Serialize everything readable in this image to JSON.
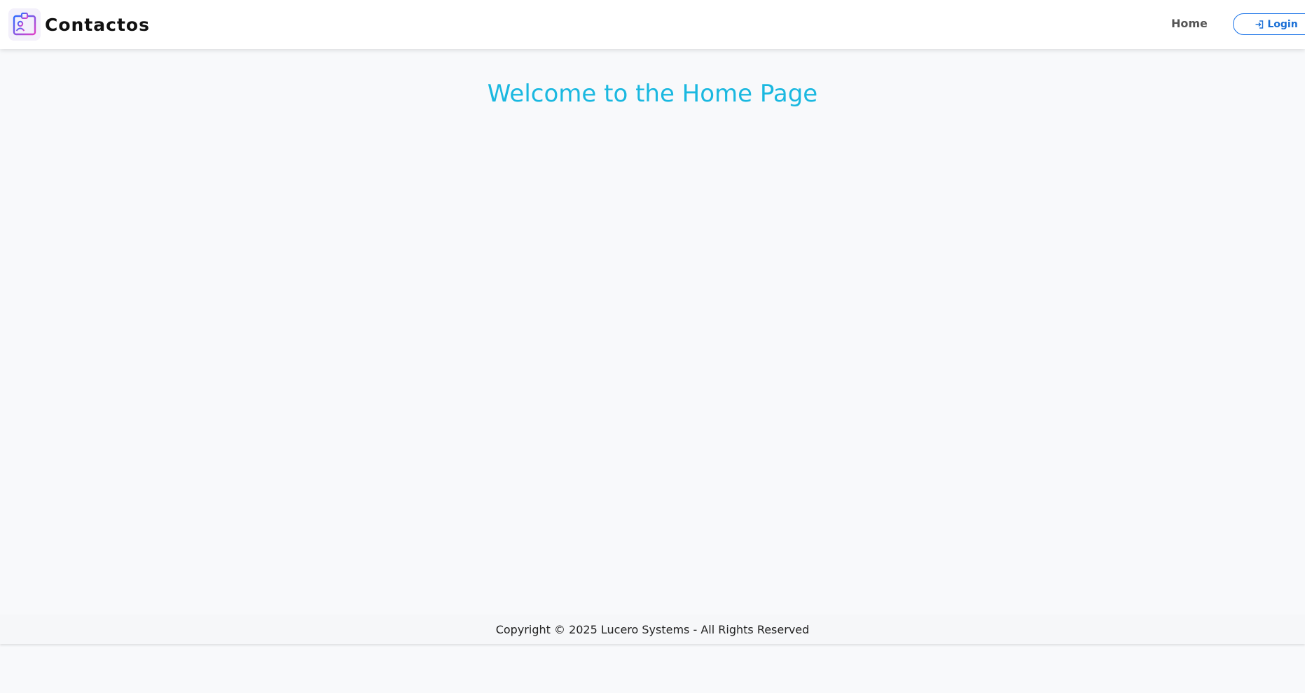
{
  "navbar": {
    "brand_label": "Contactos",
    "logo_icon": "contact-card-icon",
    "home_label": "Home",
    "login_label": "Login",
    "login_icon": "login-arrow-icon"
  },
  "main": {
    "title": "Welcome to the Home Page"
  },
  "footer": {
    "copyright": "Copyright © 2025 Lucero Systems - All Rights Reserved"
  },
  "colors": {
    "title": "#1ab8e0",
    "accent": "#1a73e8",
    "logo_gradient_start": "#2f6bff",
    "logo_gradient_end": "#e040c8"
  }
}
